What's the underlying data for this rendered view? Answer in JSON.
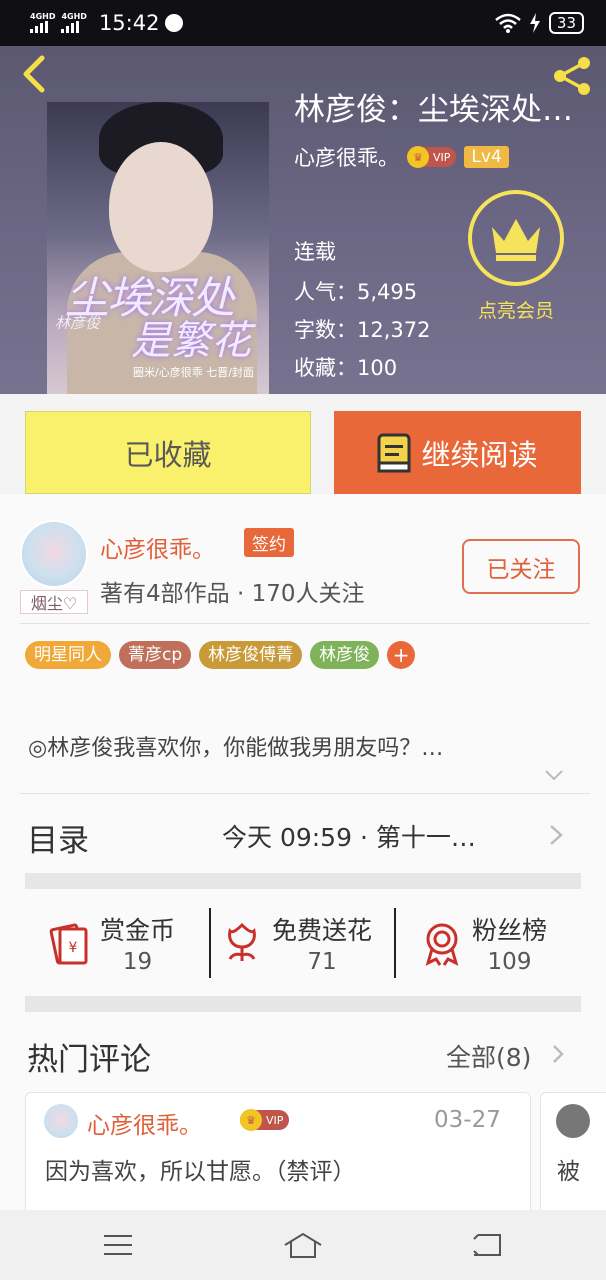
{
  "status_bar": {
    "network1": "4GHD",
    "network2": "4GHD",
    "time": "15:42",
    "battery": "33"
  },
  "book": {
    "title": "林彦俊：尘埃深处…",
    "author": "心彦很乖。",
    "vip": "VIP",
    "level": "Lv4",
    "status": "连载",
    "popularity": "人气：5,495",
    "words": "字数：12,372",
    "favorites": "收藏：100",
    "member_label": "点亮会员",
    "cover": {
      "title_line1": "尘埃深处",
      "title_line2": "是繁花",
      "name": "林彦俊",
      "credit": "圈米/心彦很乖 七晋/封面"
    }
  },
  "actions": {
    "collected": "已收藏",
    "continue_reading": "继续阅读"
  },
  "author_panel": {
    "avatar_tag": "烟尘♡",
    "name": "心彦很乖。",
    "sign_badge": "签约",
    "stats": "著有4部作品 · 170人关注",
    "follow": "已关注"
  },
  "tags": [
    {
      "label": "明星同人",
      "color": "#f0a838"
    },
    {
      "label": "菁彦cp",
      "color": "#c0705a"
    },
    {
      "label": "林彦俊傅菁",
      "color": "#c89a3a"
    },
    {
      "label": "林彦俊",
      "color": "#7fb35a"
    }
  ],
  "tag_add": "+",
  "intro": "◎林彦俊我喜欢你，你能做我男朋友吗？…",
  "toc": {
    "label": "目录",
    "update": "今天 09:59 · 第十一…"
  },
  "stats": {
    "reward": {
      "label": "赏金币",
      "value": "19"
    },
    "flowers": {
      "label": "免费送花",
      "value": "71"
    },
    "fans": {
      "label": "粉丝榜",
      "value": "109"
    }
  },
  "hot_comments": {
    "title": "热门评论",
    "all": "全部(8)",
    "items": [
      {
        "user": "心彦很乖。",
        "vip": "VIP",
        "date": "03-27",
        "text": "因为喜欢，所以甘愿。（禁评）"
      },
      {
        "text": "被"
      }
    ]
  },
  "colors": {
    "accent": "#e8683a",
    "collected_bg": "#f9f06c",
    "member_gold": "#f6e35c"
  }
}
